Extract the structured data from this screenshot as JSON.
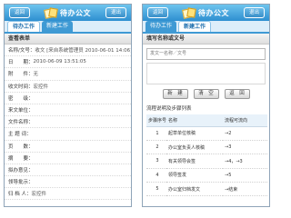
{
  "left": {
    "title": "待办公文",
    "back_label": "返回",
    "exit_label": "退出",
    "tabs": [
      {
        "label": "待办工作",
        "active": true
      },
      {
        "label": "新建工作",
        "active": false
      }
    ],
    "section_title": "查看表单",
    "form_rows": [
      {
        "label": "名称/文号：",
        "value": "收文 [来自系统管理员 2010-06-01 14:06]"
      },
      {
        "label": "日　　期：",
        "value": "2010-06-09 13:51:05"
      },
      {
        "label": "附　　件：",
        "value": "无"
      },
      {
        "label": "收文时间：",
        "value": "宏控件"
      },
      {
        "label": "密　　级：",
        "value": ""
      },
      {
        "label": "来文单位：",
        "value": ""
      },
      {
        "label": "文件名称：",
        "value": ""
      },
      {
        "label": "主 题 词：",
        "value": ""
      },
      {
        "label": "页　　数：",
        "value": ""
      },
      {
        "label": "摘　　要：",
        "value": ""
      },
      {
        "label": "拟办意见：",
        "value": ""
      },
      {
        "label": "领导批示：",
        "value": ""
      },
      {
        "label": "归 档 人：",
        "value": "宏控件"
      }
    ]
  },
  "right": {
    "title": "待办公文",
    "back_label": "返回",
    "exit_label": "退出",
    "tabs": [
      {
        "label": "待办工作",
        "active": false
      },
      {
        "label": "新建工作",
        "active": true
      }
    ],
    "section_title": "填写名称或文号",
    "name_field_value": "发文一名称／文号",
    "buttons": {
      "new": "新　建",
      "clear": "清　空",
      "back": "返　回"
    },
    "flow_title": "流程说明及步骤列表",
    "table_headers": [
      "步骤序号",
      "名称",
      "流程可流向"
    ],
    "steps": [
      {
        "no": "1",
        "name": "起草单位核稿",
        "next": "→2"
      },
      {
        "no": "2",
        "name": "办公室负责人核稿",
        "next": "→3"
      },
      {
        "no": "3",
        "name": "有关领导会签",
        "next": "→4，→3"
      },
      {
        "no": "4",
        "name": "领导签发",
        "next": "→5"
      },
      {
        "no": "5",
        "name": "办公室归档发文",
        "next": "→结束"
      }
    ]
  }
}
